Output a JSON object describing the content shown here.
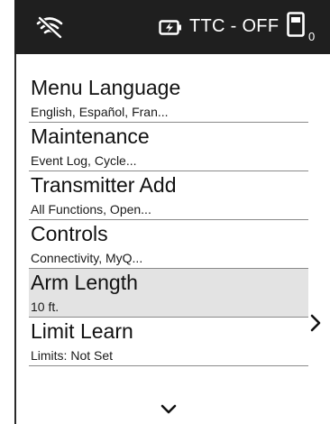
{
  "status_bar": {
    "wifi_icon": "wifi-off-icon",
    "battery_icon": "battery-charging-icon",
    "ttc_status": "TTC - OFF",
    "remote_icon": "remote-icon",
    "remote_count": "0"
  },
  "menu": {
    "items": [
      {
        "title": "Menu Language",
        "subtitle": "English, Español, Fran..."
      },
      {
        "title": "Maintenance",
        "subtitle": "Event Log, Cycle..."
      },
      {
        "title": "Transmitter Add",
        "subtitle": "All Functions, Open..."
      },
      {
        "title": "Controls",
        "subtitle": "Connectivity, MyQ..."
      },
      {
        "title": "Arm Length",
        "subtitle": "10 ft."
      },
      {
        "title": "Limit Learn",
        "subtitle": "Limits: Not Set"
      }
    ],
    "selected_index": 4
  },
  "navigation": {
    "right_icon": "chevron-right-icon",
    "down_icon": "chevron-down-icon"
  },
  "colors": {
    "status_bar_bg": "#1f1f1f",
    "selected_row_bg": "#e3e3e3"
  }
}
